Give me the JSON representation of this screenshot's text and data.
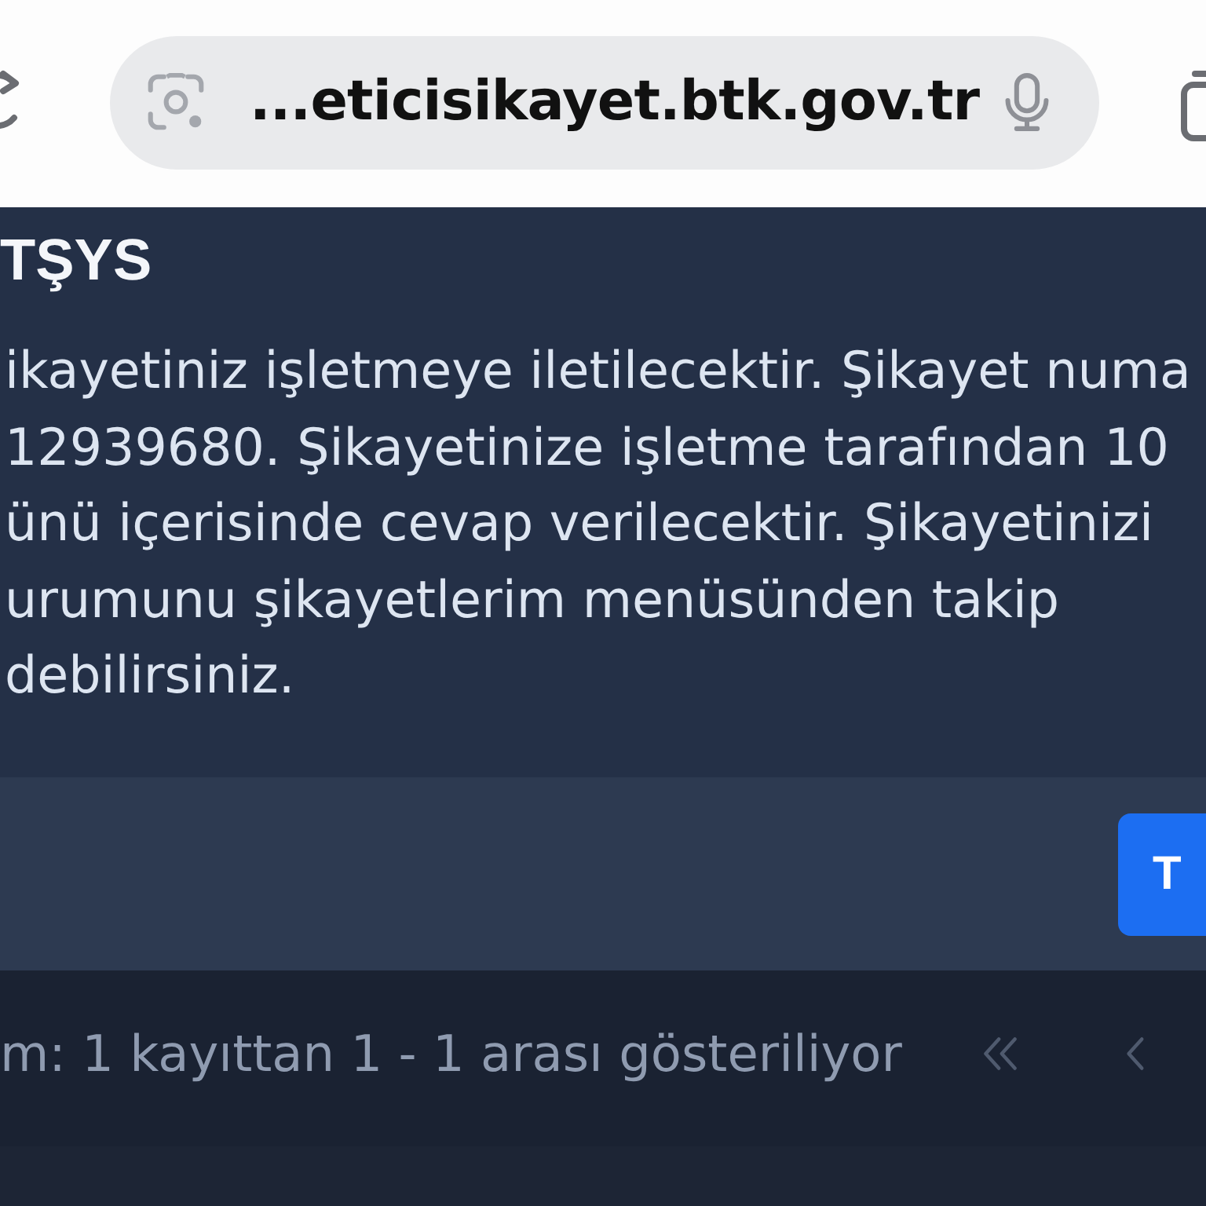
{
  "browser": {
    "url": "...eticisikayet.btk.gov.tr"
  },
  "dialog": {
    "title": "TŞYS",
    "message_lines": [
      "ikayetiniz işletmeye iletilecektir. Şikayet numa",
      "12939680. Şikayetinize işletme tarafından 10",
      "ünü içerisinde cevap verilecektir. Şikayetinizi",
      "urumunu şikayetlerim menüsünden takip",
      "debilirsiniz."
    ]
  },
  "action_bar": {
    "button": {
      "label": "T"
    }
  },
  "footer": {
    "summary": "m: 1 kayıttan 1 - 1 arası gösteriliyor",
    "pagination": [
      {
        "kind": "first",
        "disabled": true
      },
      {
        "kind": "previous",
        "disabled": true
      }
    ]
  }
}
